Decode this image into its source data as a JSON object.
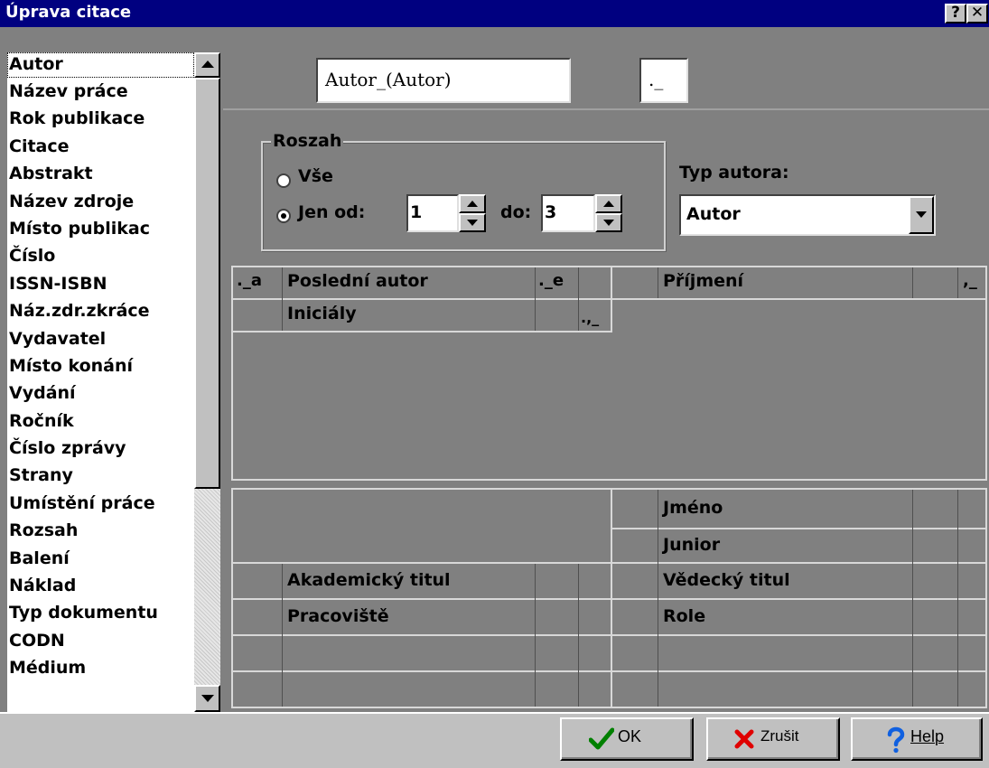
{
  "window": {
    "title": "Úprava citace",
    "help_btn": "?",
    "close_btn": "✕"
  },
  "fields_list": {
    "items": [
      "Autor",
      "Název práce",
      "Rok publikace",
      "Citace",
      "Abstrakt",
      "Název zdroje",
      "Místo publikac",
      "Číslo",
      "ISSN-ISBN",
      "Náz.zdr.zkráce",
      "Vydavatel",
      "Místo konání",
      "Vydání",
      "Ročník",
      "Číslo zprávy",
      "Strany",
      "Umístění práce",
      "Rozsah",
      "Balení",
      "Náklad",
      "Typ dokumentu",
      "CODN",
      "Médium"
    ],
    "selected": "Autor"
  },
  "top": {
    "field_name": "Autor_(Autor)",
    "separator": "._"
  },
  "rozsah": {
    "label": "Roszah",
    "all_label": "Vše",
    "only_from_label": "Jen od:",
    "from_value": "1",
    "to_label": "do:",
    "to_value": "3",
    "selected": "only_from"
  },
  "typ_autora": {
    "label": "Typ autora:",
    "value": "Autor"
  },
  "grid_top": {
    "prefix_a": "._a",
    "last_author": "Poslední autor",
    "suffix_e": "._e",
    "surname": "Příjmení",
    "surname_suffix": ",_",
    "initials": "Iniciály",
    "initials_suffix": ".,_"
  },
  "grid_bottom": {
    "first_name": "Jméno",
    "junior": "Junior",
    "academic_title": "Akademický titul",
    "scientific_title": "Vědecký titul",
    "workplace": "Pracoviště",
    "role": "Role"
  },
  "buttons": {
    "ok": "OK",
    "cancel": "Zrušit",
    "help": "Help"
  },
  "colors": {
    "titlebar": "#000080",
    "panel": "#808080",
    "face": "#c0c0c0",
    "ok_check": "#008000",
    "cancel_x": "#e00000",
    "help_q": "#1060e0"
  }
}
